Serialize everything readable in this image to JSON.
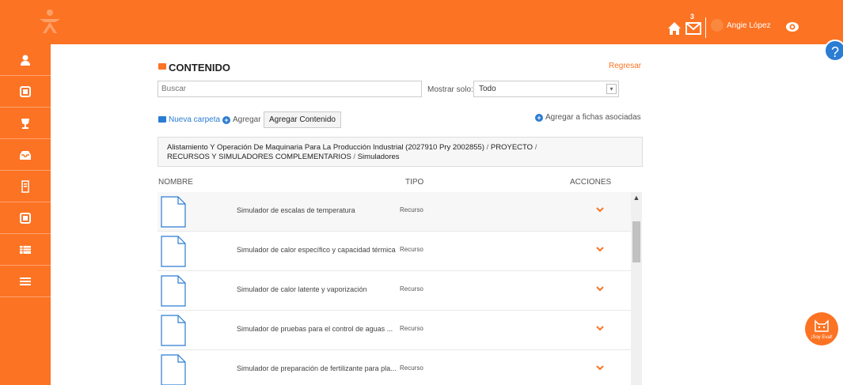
{
  "topbar": {
    "logo_icon": "sena-logo-icon",
    "home_icon": "home-icon",
    "mail_icon": "mail-icon",
    "mail_count": "3",
    "username": "Angie López",
    "eye_icon": "eye-icon",
    "help_icon": "help-icon",
    "help_glyph": "?"
  },
  "sidebar": {
    "items": [
      {
        "icon": "user-icon"
      },
      {
        "icon": "card-icon"
      },
      {
        "icon": "trophy-icon"
      },
      {
        "icon": "inbox-icon"
      },
      {
        "icon": "document-icon"
      },
      {
        "icon": "card-icon"
      },
      {
        "icon": "table-icon"
      },
      {
        "icon": "menu-icon"
      }
    ]
  },
  "content": {
    "title": "CONTENIDO",
    "back_label": "Regresar",
    "search_placeholder": "Buscar",
    "filter_label": "Mostrar solo:",
    "filter_value": "Todo",
    "new_folder_label": "Nueva carpeta",
    "add_label": "Agregar",
    "add_content_label": "Agregar Contenido",
    "assoc_label": "Agregar a fichas asociadas",
    "breadcrumb": {
      "part1": "Alistamiento Y Operación De Maquinaria Para La Producción Industrial (2027910 Pry 2002855)",
      "sep1": " / ",
      "part2": "PROYECTO",
      "sep2": " / ",
      "part3": "RECURSOS Y SIMULADORES COMPLEMENTARIOS",
      "sep3": " / ",
      "part4": "Simuladores"
    },
    "columns": {
      "name": "NOMBRE",
      "type": "TIPO",
      "actions": "ACCIONES"
    },
    "rows": [
      {
        "name": "Simulador de escalas de temperatura",
        "type": "Recurso"
      },
      {
        "name": "Simulador de calor específico y capacidad térmica",
        "type": "Recurso"
      },
      {
        "name": "Simulador de calor latente y vaporización",
        "type": "Recurso"
      },
      {
        "name": "Simulador de pruebas para el control de aguas ...",
        "type": "Recurso"
      },
      {
        "name": "Simulador de preparación de fertilizante para pla...",
        "type": "Recurso"
      }
    ]
  },
  "eval_widget": {
    "label": "¡Soy Eval!"
  },
  "colors": {
    "brand_orange": "#fc7323",
    "link_blue": "#2b7cd3"
  }
}
